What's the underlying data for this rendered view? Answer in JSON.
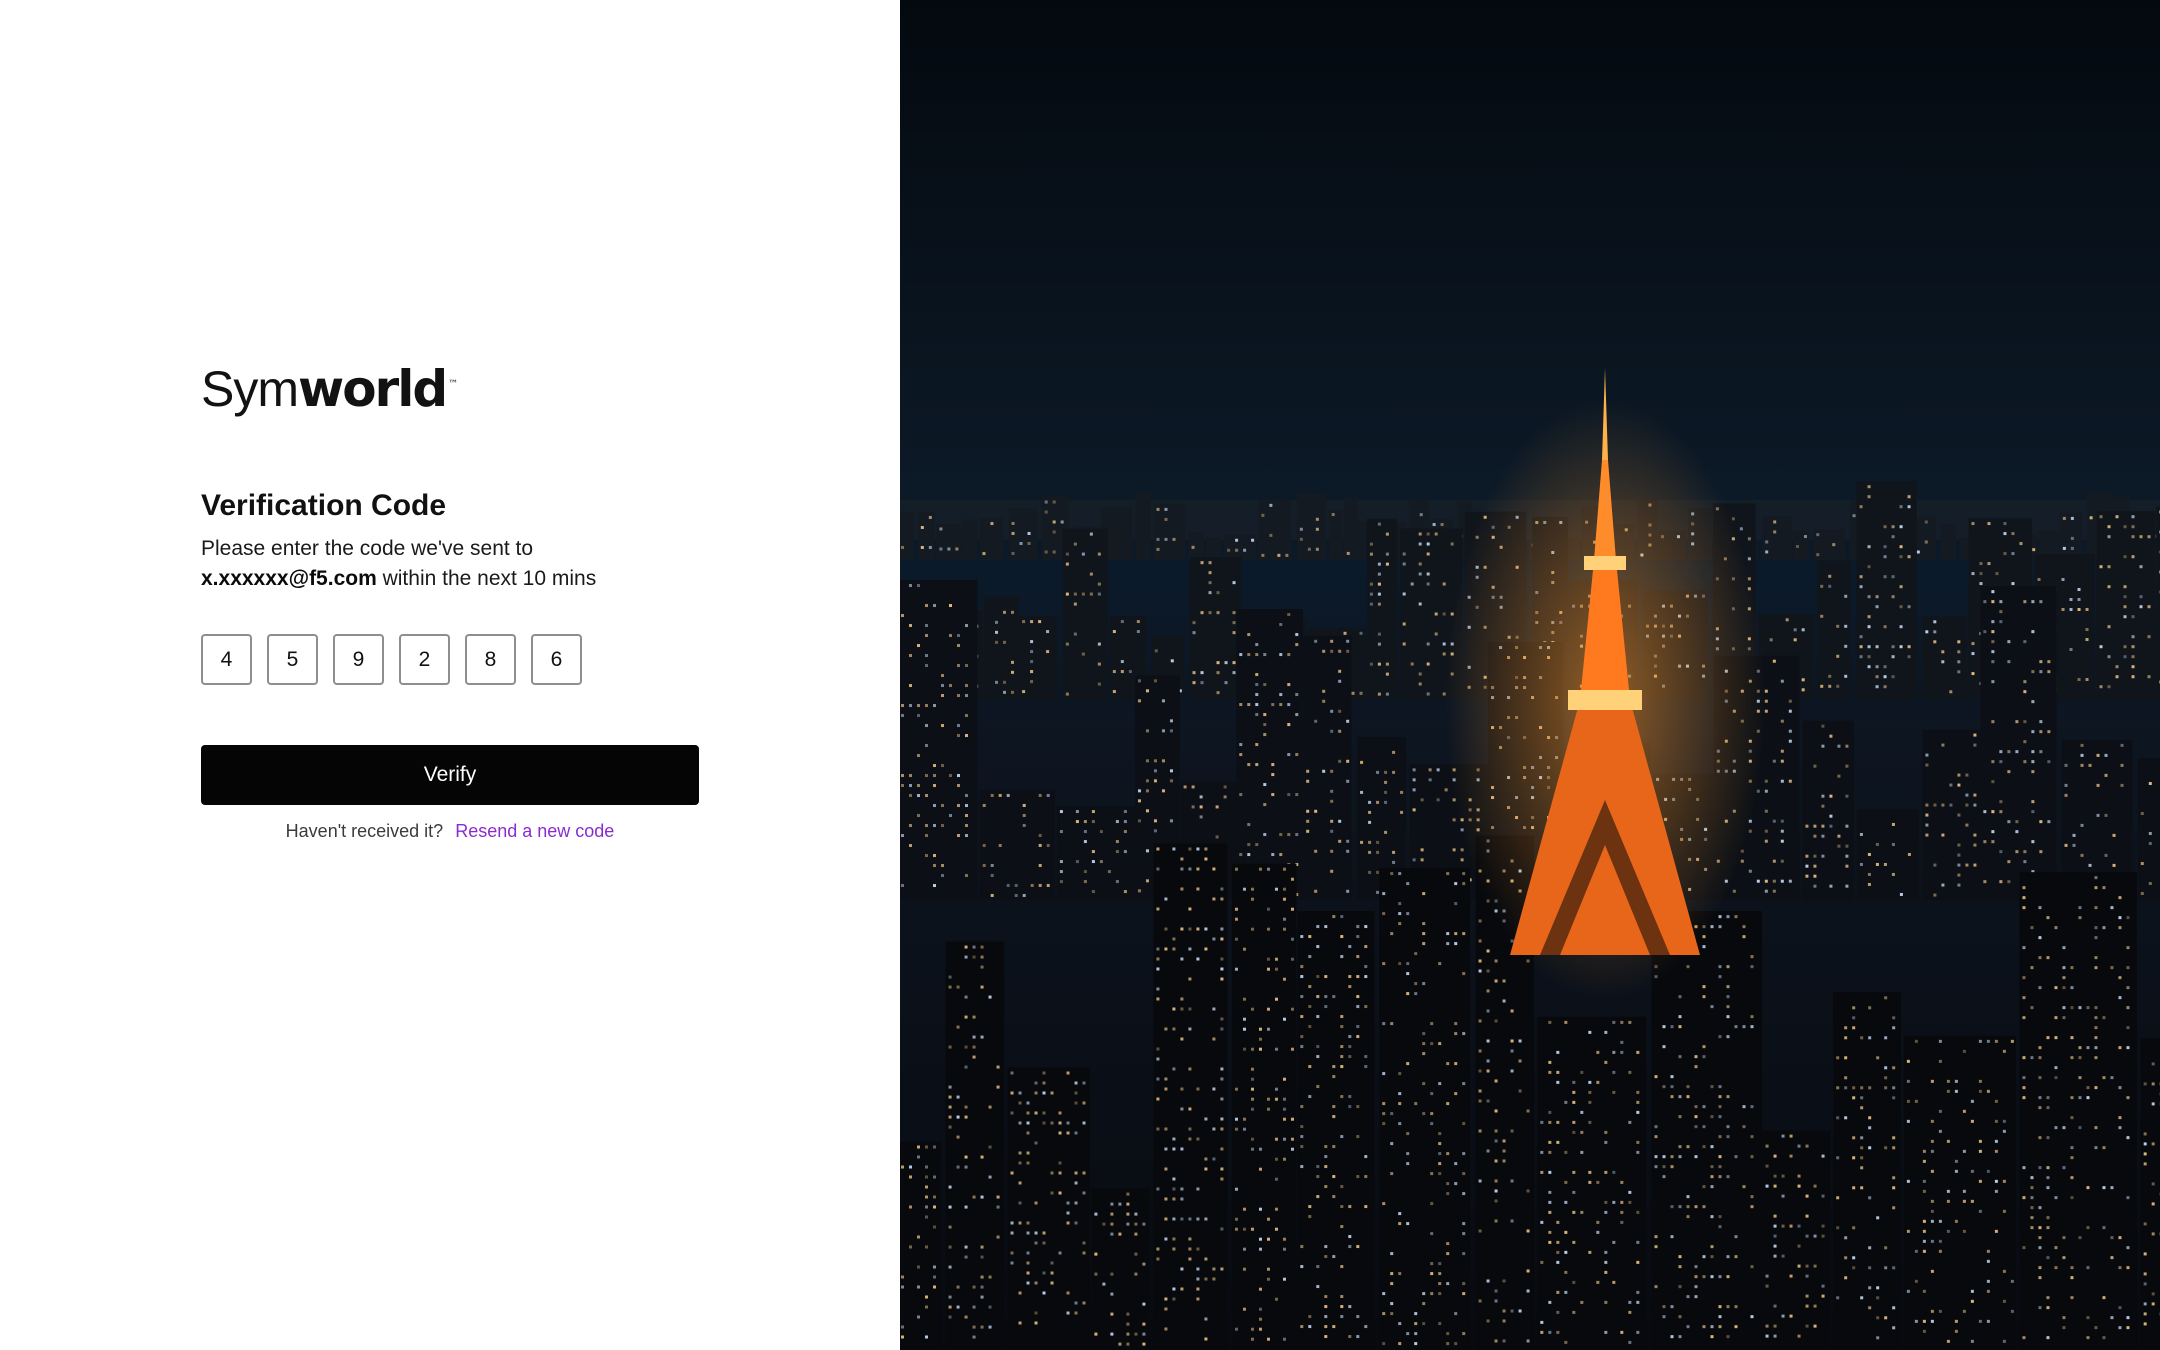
{
  "brand": {
    "logo_light": "Sym",
    "logo_bold": "world",
    "trademark": "™"
  },
  "verification": {
    "title": "Verification Code",
    "description_line1": "Please enter the code we've sent to",
    "email": "x.xxxxxx@f5.com",
    "description_suffix": " within the next 10 mins",
    "code_digits": [
      "4",
      "5",
      "9",
      "2",
      "8",
      "6"
    ],
    "verify_label": "Verify",
    "resend_prompt": "Haven't received it?",
    "resend_link": "Resend a new code"
  },
  "colors": {
    "button_bg": "#050505",
    "link": "#8a2bd1"
  },
  "hero_image": {
    "icon": "city-night-tokyo-tower-image"
  }
}
